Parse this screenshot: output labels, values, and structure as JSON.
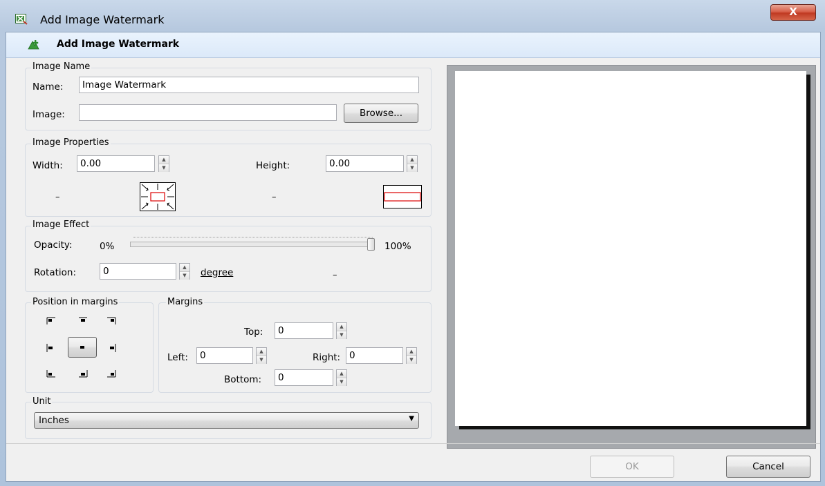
{
  "window": {
    "title": "Add Image Watermark",
    "close_glyph": "X",
    "app_icon": "excel-app-icon"
  },
  "header": {
    "title": "Add Image Watermark",
    "icon": "add-image-icon"
  },
  "image_name": {
    "group_label": "Image Name",
    "name_label": "Name:",
    "name_value": "Image Watermark",
    "image_label": "Image:",
    "image_value": "",
    "browse_label": "Browse..."
  },
  "image_properties": {
    "group_label": "Image Properties",
    "width_label": "Width:",
    "width_value": "0.00",
    "height_label": "Height:",
    "height_value": "0.00",
    "width_dash": "–",
    "height_dash": "–"
  },
  "image_effect": {
    "group_label": "Image Effect",
    "opacity_label": "Opacity:",
    "opacity_min": "0%",
    "opacity_max": "100%",
    "opacity_level": 1.0,
    "rotation_label": "Rotation:",
    "rotation_value": "0",
    "degree_label": "degree",
    "dash": "–"
  },
  "position": {
    "group_label": "Position in margins",
    "selected": "middle-center"
  },
  "margins": {
    "group_label": "Margins",
    "top_label": "Top:",
    "top_value": "0",
    "left_label": "Left:",
    "left_value": "0",
    "right_label": "Right:",
    "right_value": "0",
    "bottom_label": "Bottom:",
    "bottom_value": "0"
  },
  "unit": {
    "group_label": "Unit",
    "selected": "Inches"
  },
  "buttons": {
    "ok": "OK",
    "cancel": "Cancel"
  },
  "colors": {
    "accent": "#3b7fd6",
    "close_red": "#c8442b",
    "preview_bg": "#a6a9ad"
  }
}
